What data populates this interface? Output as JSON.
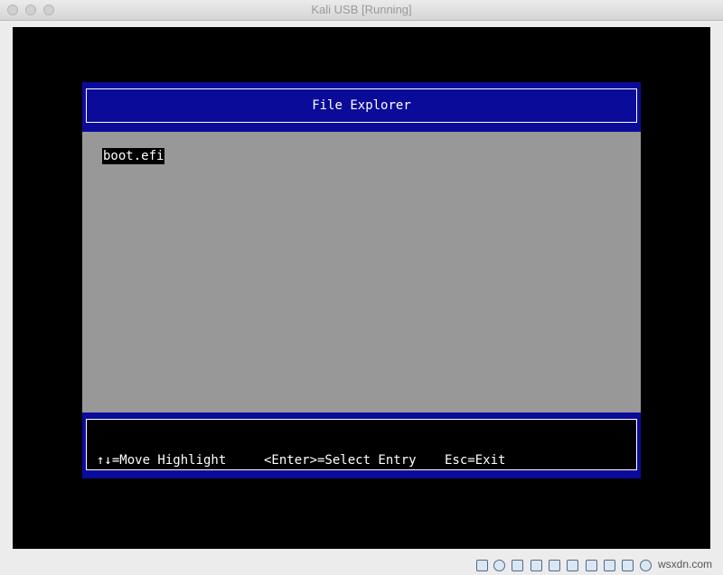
{
  "window": {
    "title": "Kali USB [Running]"
  },
  "file_explorer": {
    "title": "File Explorer",
    "items": [
      {
        "label": "boot.efi",
        "selected": true
      }
    ],
    "help": {
      "move": "↑↓=Move Highlight",
      "select": "<Enter>=Select Entry",
      "exit": "Esc=Exit"
    }
  },
  "statusbar": {
    "icons": [
      "hard-disk-icon",
      "optical-drive-icon",
      "audio-icon",
      "network-icon",
      "usb-icon",
      "shared-folders-icon",
      "display-icon",
      "video-capture-icon",
      "mouse-integration-icon",
      "cpu-icon",
      "keyboard-icon"
    ],
    "watermark": "wsxdn.com"
  },
  "colors": {
    "bios_blue": "#0b0b9a",
    "panel_gray": "#989898",
    "screen_black": "#000000"
  }
}
